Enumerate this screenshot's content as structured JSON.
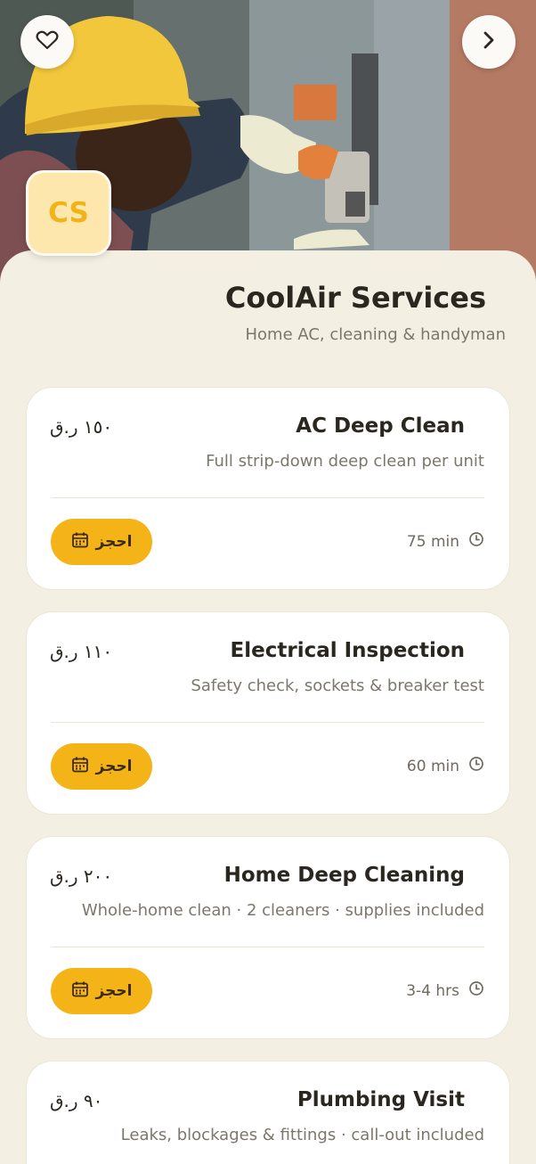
{
  "colors": {
    "accent": "#f4b316",
    "background": "#f3efe3",
    "card": "#ffffff",
    "logo_bg": "#fde7ad",
    "logo_text": "#f2b31a"
  },
  "hero": {
    "image": "technician-working-on-electrical-panel"
  },
  "header": {
    "favorite_icon": "heart-icon",
    "next_icon": "chevron-right-icon"
  },
  "provider": {
    "logo_text": "CS",
    "name": "CoolAir Services",
    "tagline": "Home AC, cleaning & handyman"
  },
  "services": [
    {
      "name": "AC Deep Clean",
      "price": "١٥٠ ر.ق",
      "description": "Full strip-down deep clean per unit",
      "duration": "75 min",
      "book_label": "احجز"
    },
    {
      "name": "Electrical Inspection",
      "price": "١١٠ ر.ق",
      "description": "Safety check, sockets & breaker test",
      "duration": "60 min",
      "book_label": "احجز"
    },
    {
      "name": "Home Deep Cleaning",
      "price": "٢٠٠ ر.ق",
      "description": "Whole-home clean · 2 cleaners · supplies included",
      "duration": "3-4 hrs",
      "book_label": "احجز"
    },
    {
      "name": "Plumbing Visit",
      "price": "٩٠ ر.ق",
      "description": "Leaks, blockages & fittings · call-out included"
    }
  ]
}
